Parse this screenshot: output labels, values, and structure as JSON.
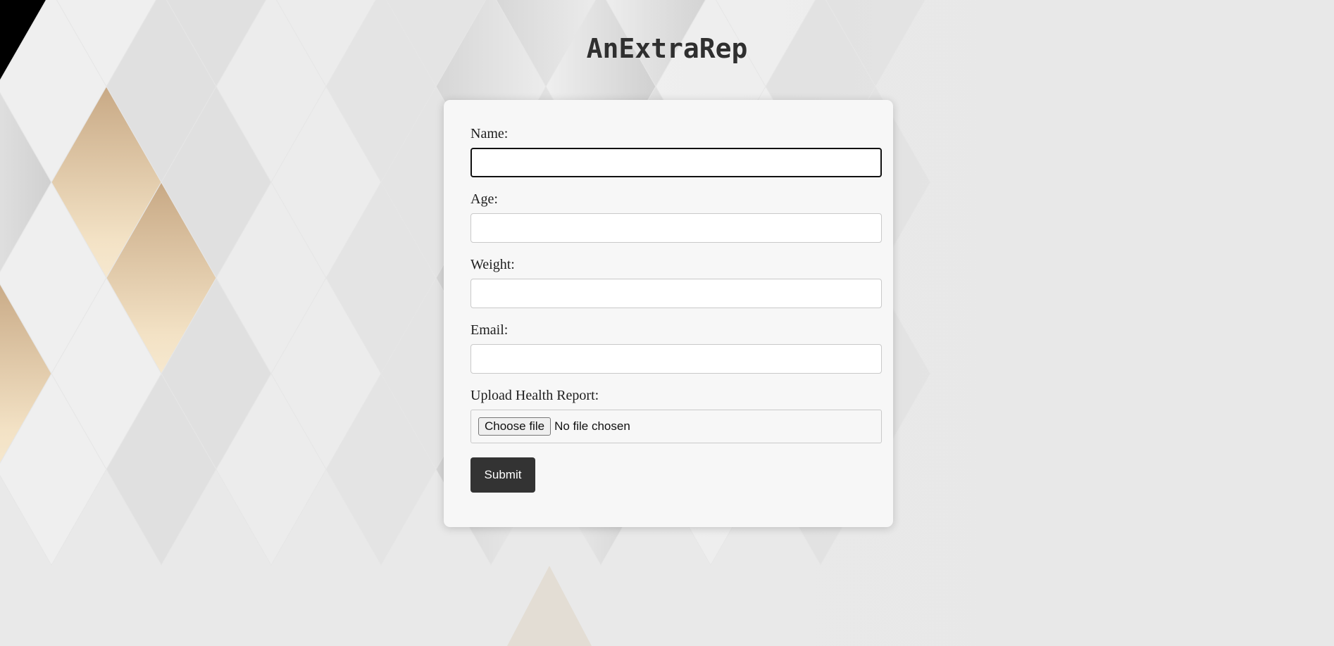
{
  "header": {
    "title": "AnExtraRep"
  },
  "form": {
    "fields": [
      {
        "label": "Name:",
        "value": ""
      },
      {
        "label": "Age:",
        "value": ""
      },
      {
        "label": "Weight:",
        "value": ""
      },
      {
        "label": "Email:",
        "value": ""
      }
    ],
    "upload": {
      "label": "Upload Health Report:",
      "button_label": "Choose file",
      "status": "No file chosen"
    },
    "submit_label": "Submit"
  },
  "colors": {
    "background": "#e8e8e8",
    "card": "#f7f7f7",
    "submit": "#333333",
    "accent_gold": "#d2b48c"
  }
}
